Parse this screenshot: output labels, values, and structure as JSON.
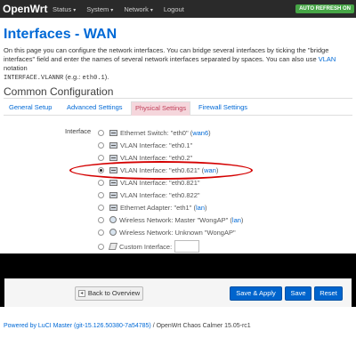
{
  "header": {
    "brand": "OpenWrt",
    "nav": [
      {
        "label": "Status"
      },
      {
        "label": "System"
      },
      {
        "label": "Network"
      },
      {
        "label": "Logout"
      }
    ],
    "autorefresh": "AUTO REFRESH ON"
  },
  "page": {
    "title": "Interfaces - WAN",
    "desc_part1": "On this page you can configure the network interfaces. You can bridge several interfaces by ticking the \"bridge interfaces\" field and enter the names of several network interfaces separated by spaces. You can also use ",
    "desc_vlan": "VLAN",
    "desc_part2": " notation",
    "desc_code1": "INTERFACE.VLANNR",
    "desc_eg": " (e.g.: ",
    "desc_code2": "eth0.1",
    "desc_end": ")."
  },
  "section": {
    "title": "Common Configuration",
    "tabs": [
      "General Setup",
      "Advanced Settings",
      "Physical Settings",
      "Firewall Settings"
    ],
    "active_tab": "Physical Settings"
  },
  "interface_field": {
    "label": "Interface",
    "options": [
      {
        "text": "Ethernet Switch: \"eth0\"",
        "link": "wan6",
        "icon": "ethernet-switch-icon",
        "checked": false
      },
      {
        "text": "VLAN Interface: \"eth0.1\"",
        "link": "",
        "icon": "vlan-icon",
        "checked": false
      },
      {
        "text": "VLAN Interface: \"eth0.2\"",
        "link": "",
        "icon": "vlan-icon",
        "checked": false
      },
      {
        "text": "VLAN Interface: \"eth0.621\"",
        "link": "wan",
        "icon": "vlan-icon",
        "checked": true
      },
      {
        "text": "VLAN Interface: \"eth0.821\"",
        "link": "",
        "icon": "vlan-icon",
        "checked": false
      },
      {
        "text": "VLAN Interface: \"eth0.822\"",
        "link": "",
        "icon": "vlan-icon",
        "checked": false
      },
      {
        "text": "Ethernet Adapter: \"eth1\"",
        "link": "lan",
        "icon": "ethernet-adapter-icon",
        "checked": false
      },
      {
        "text": "Wireless Network: Master \"WongAP\"",
        "link": "lan",
        "icon": "wireless-icon",
        "checked": false
      },
      {
        "text": "Wireless Network: Unknown \"WongAP\"",
        "link": "",
        "icon": "wireless-icon",
        "checked": false
      },
      {
        "text": "Custom Interface:",
        "link": "",
        "icon": "custom-interface-icon",
        "checked": false
      }
    ],
    "custom_value": ""
  },
  "actions": {
    "back": "Back to Overview",
    "save_apply": "Save & Apply",
    "save": "Save",
    "reset": "Reset"
  },
  "footer": {
    "link": "Powered by LuCI Master (git-15.126.50380-7a54785)",
    "rest": " / OpenWrt Chaos Calmer 15.05-rc1"
  },
  "colors": {
    "accent": "#0069d6",
    "primary_button": "#0064cd",
    "active_tab_bg": "#f5d6dc",
    "highlight": "#d40000",
    "autorefresh": "#46a546"
  }
}
